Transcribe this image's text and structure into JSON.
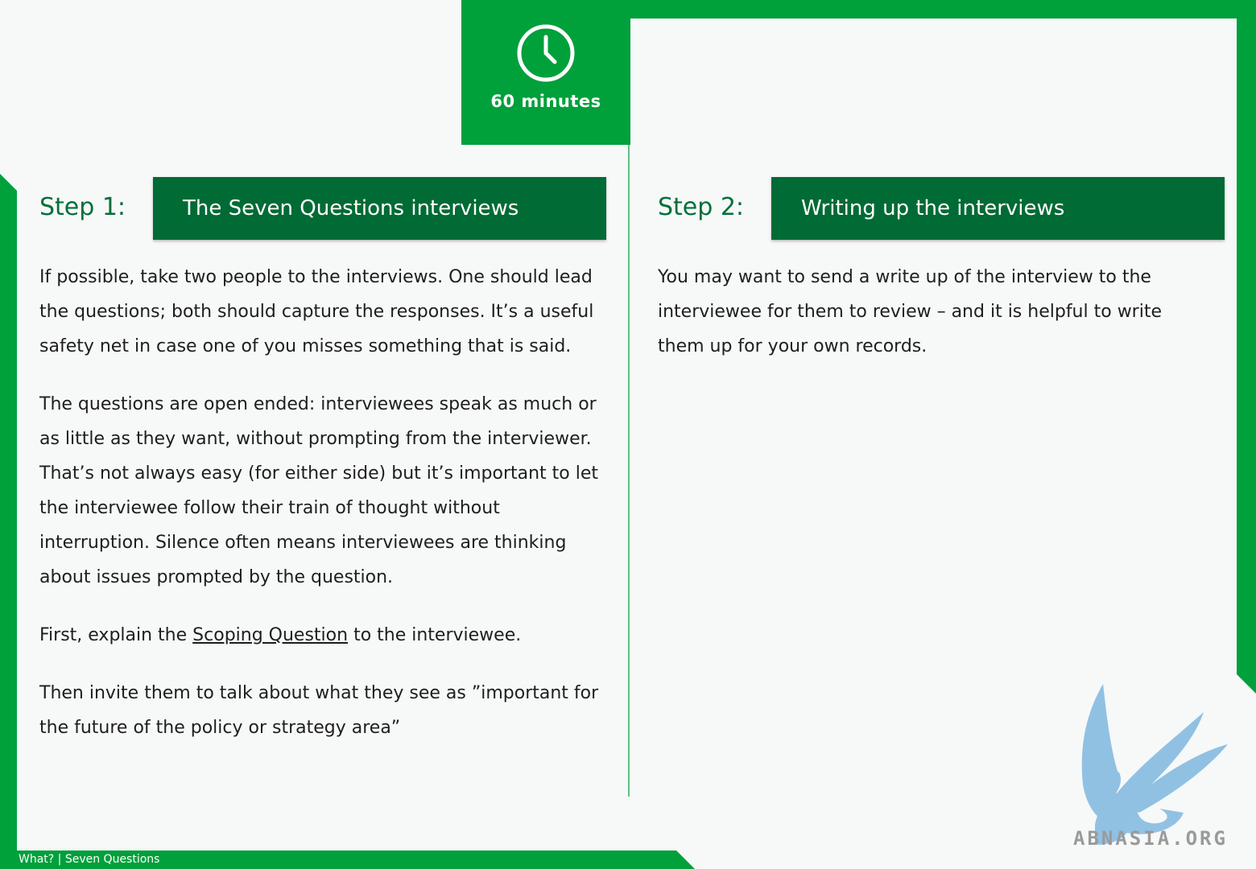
{
  "timer": {
    "icon": "clock-icon",
    "label": "60 minutes"
  },
  "step1": {
    "number": "Step 1:",
    "title": "The Seven Questions interviews",
    "paragraphs": [
      "If possible, take two people to the interviews. One should lead the questions; both should capture the responses. It’s a useful safety net in case one of you misses something that is said.",
      "The questions are open ended: interviewees speak as much or as little as they want, without prompting from the interviewer. That’s not always easy (for either side) but it’s important to let the interviewee follow their train of thought without interruption. Silence often means interviewees are thinking about issues prompted by the question."
    ],
    "scoping": {
      "before": "First, explain the ",
      "link": "Scoping Question",
      "after": " to the interviewee."
    },
    "closing": "Then invite them to talk about what they see as ”important for the future of the policy or strategy area”"
  },
  "step2": {
    "number": "Step 2:",
    "title": "Writing up the interviews",
    "paragraphs": [
      "You may want to send a write up of the interview to the interviewee for them to review – and it is helpful to write them up for your own records."
    ]
  },
  "footer": {
    "text": "What? |  Seven Questions"
  },
  "watermark": {
    "text": "ABNASIA.ORG"
  },
  "colors": {
    "accent": "#00a03b",
    "dark_green": "#006b35",
    "heading_green": "#00703a"
  }
}
